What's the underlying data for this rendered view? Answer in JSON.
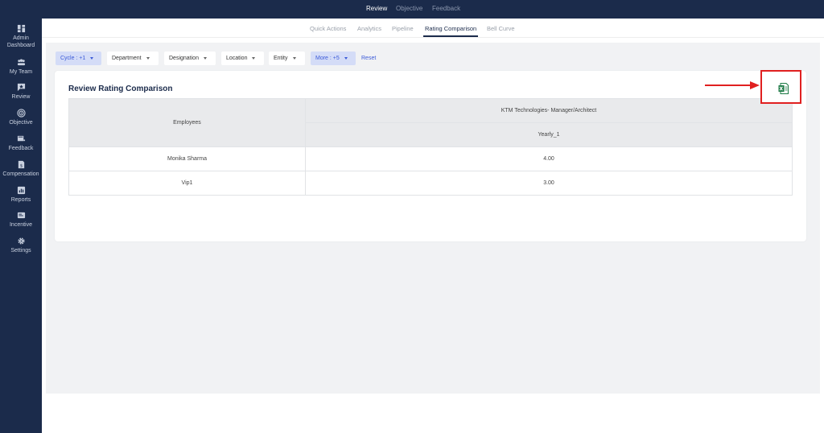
{
  "top_tabs": [
    "Review",
    "Objective",
    "Feedback"
  ],
  "sidebar": {
    "items": [
      {
        "label_line1": "Admin",
        "label_line2": "Dashboard",
        "icon": "dashboard-icon"
      },
      {
        "label_line1": "My Team",
        "label_line2": "",
        "icon": "team-icon"
      },
      {
        "label_line1": "Review",
        "label_line2": "",
        "icon": "review-icon"
      },
      {
        "label_line1": "Objective",
        "label_line2": "",
        "icon": "target-icon"
      },
      {
        "label_line1": "Feedback",
        "label_line2": "",
        "icon": "feedback-icon"
      },
      {
        "label_line1": "Compensation",
        "label_line2": "",
        "icon": "compensation-icon"
      },
      {
        "label_line1": "Reports",
        "label_line2": "",
        "icon": "reports-icon"
      },
      {
        "label_line1": "Incentive",
        "label_line2": "",
        "icon": "incentive-icon"
      },
      {
        "label_line1": "Settings",
        "label_line2": "",
        "icon": "gear-icon"
      }
    ]
  },
  "sub_tabs": [
    "Quick Actions",
    "Analytics",
    "Pipeline",
    "Rating Comparison",
    "Bell Curve"
  ],
  "filters": {
    "cycle": "Cycle : +1",
    "department": "Department",
    "designation": "Designation",
    "location": "Location",
    "entity": "Entity",
    "more": "More : +5",
    "reset": "Reset"
  },
  "card": {
    "title": "Review Rating Comparison"
  },
  "table": {
    "employees_header": "Employees",
    "group_header": "KTM Technologies- Manager/Architect",
    "cycle_header": "Yearly_1",
    "rows": [
      {
        "name": "Monika Sharma",
        "value": "4.00"
      },
      {
        "name": "Vip1",
        "value": "3.00"
      }
    ]
  },
  "colors": {
    "sidebar_bg": "#1b2b4b",
    "accent_blue": "#3c5bd8",
    "highlight_red": "#e02020",
    "excel_green": "#1d7a45"
  }
}
